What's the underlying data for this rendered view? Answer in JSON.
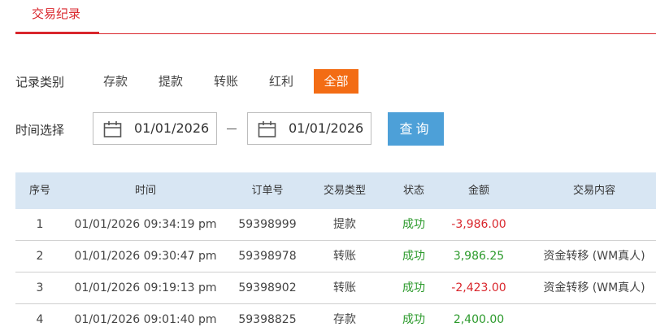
{
  "tabs": {
    "active_label": "交易纪录"
  },
  "filter": {
    "category_label": "记录类别",
    "categories": [
      "存款",
      "提款",
      "转账",
      "红利",
      "全部"
    ],
    "time_label": "时间选择",
    "start_date": "01/01/2026",
    "end_date": "01/01/2026",
    "query_label": "查询"
  },
  "table": {
    "headers": [
      "序号",
      "时间",
      "订单号",
      "交易类型",
      "状态",
      "金额",
      "交易内容"
    ],
    "rows": [
      {
        "no": "1",
        "time": "01/01/2026 09:34:19 pm",
        "order": "59398999",
        "type": "提款",
        "status": "成功",
        "amount": "-3,986.00",
        "content": ""
      },
      {
        "no": "2",
        "time": "01/01/2026 09:30:47 pm",
        "order": "59398978",
        "type": "转账",
        "status": "成功",
        "amount": "3,986.25",
        "content": "资金转移 (WM真人)"
      },
      {
        "no": "3",
        "time": "01/01/2026 09:19:13 pm",
        "order": "59398902",
        "type": "转账",
        "status": "成功",
        "amount": "-2,423.00",
        "content": "资金转移 (WM真人)"
      },
      {
        "no": "4",
        "time": "01/01/2026 09:01:40 pm",
        "order": "59398825",
        "type": "存款",
        "status": "成功",
        "amount": "2,400.00",
        "content": ""
      }
    ]
  },
  "colors": {
    "accent_red": "#d9262c",
    "active_orange": "#f36c14",
    "query_blue": "#4da0d8",
    "header_bg": "#d8e6f3",
    "success_green": "#2c9a2c"
  }
}
